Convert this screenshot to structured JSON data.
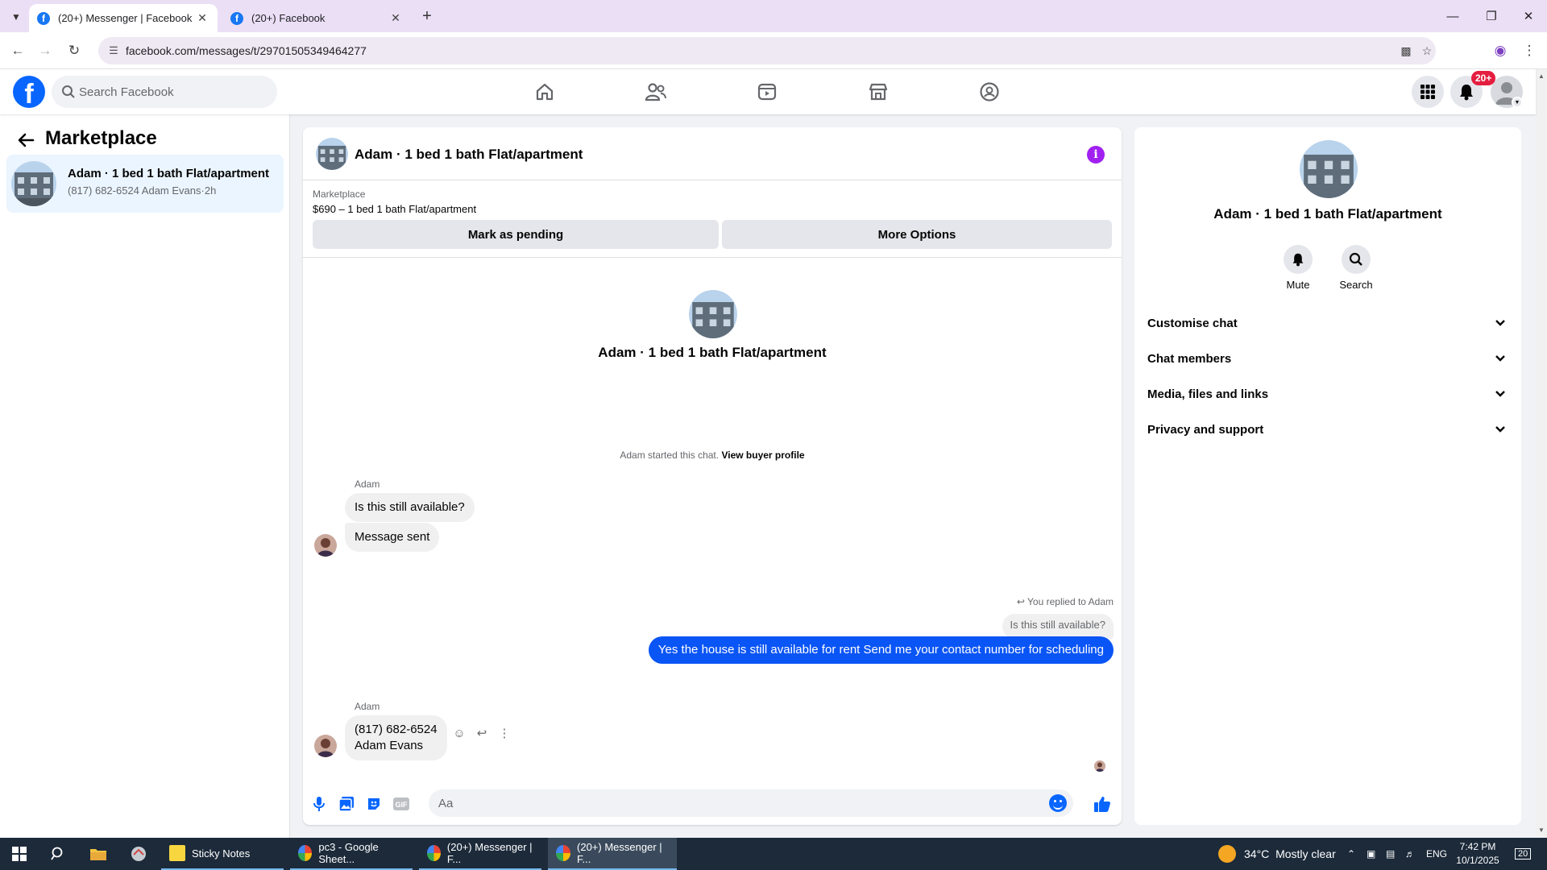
{
  "browser": {
    "tabs": [
      {
        "label": "(20+) Messenger | Facebook",
        "active": true
      },
      {
        "label": "(20+) Facebook",
        "active": false
      }
    ],
    "url": "facebook.com/messages/t/29701505349464277",
    "icons": [
      "tab-list-icon",
      "new-tab-icon",
      "minimize-icon",
      "maximize-icon",
      "close-icon",
      "back-icon",
      "forward-icon",
      "reload-icon",
      "site-info-icon",
      "install-icon",
      "bookmark-star-icon",
      "profile-icon",
      "menu-icon"
    ]
  },
  "fb_header": {
    "search_placeholder": "Search Facebook",
    "notification_badge": "20+",
    "nav_icons": [
      "home-icon",
      "friends-icon",
      "video-icon",
      "marketplace-icon",
      "groups-icon"
    ]
  },
  "left": {
    "title": "Marketplace",
    "conversation": {
      "title": "Adam · 1 bed 1 bath Flat/apartment",
      "snippet": "(817) 682-6524 Adam Evans",
      "time": "2h"
    }
  },
  "chat": {
    "header_name": "Adam · 1 bed 1 bath Flat/apartment",
    "marketplace_label": "Marketplace",
    "listing": "$690 – 1 bed 1 bath Flat/apartment",
    "mark_pending": "Mark as pending",
    "more_options": "More Options",
    "intro_name": "Adam · 1 bed 1 bath Flat/apartment",
    "started_text": "Adam started this chat.",
    "view_buyer": "View buyer profile",
    "messages": {
      "sender1": "Adam",
      "m1": "Is this still available?",
      "m2": "Message sent",
      "replied": "You replied to Adam",
      "quoted": "Is this still available?",
      "reply": "Yes the house is still available for rent Send me your contact number for scheduling",
      "sender2": "Adam",
      "m3_line1": "(817) 682-6524",
      "m3_line2": "Adam Evans"
    },
    "composer_placeholder": "Aa"
  },
  "right": {
    "name": "Adam · 1 bed 1 bath Flat/apartment",
    "mute": "Mute",
    "search": "Search",
    "sections": [
      "Customise chat",
      "Chat members",
      "Media, files and links",
      "Privacy and support"
    ]
  },
  "taskbar": {
    "apps": [
      {
        "label": "Sticky Notes"
      },
      {
        "label": "pc3 - Google Sheet..."
      },
      {
        "label": "(20+) Messenger | F..."
      },
      {
        "label": "(20+) Messenger | F..."
      }
    ],
    "weather_temp": "34°C",
    "weather_text": "Mostly clear",
    "lang": "ENG",
    "time": "7:42 PM",
    "date": "10/1/2025",
    "notif_count": "20"
  },
  "colors": {
    "fb_blue": "#0866ff",
    "out_bubble": "#0a55f5",
    "selected_convo": "#ebf5ff",
    "info_purple": "#a020f0",
    "badge_red": "#e41e3f"
  }
}
